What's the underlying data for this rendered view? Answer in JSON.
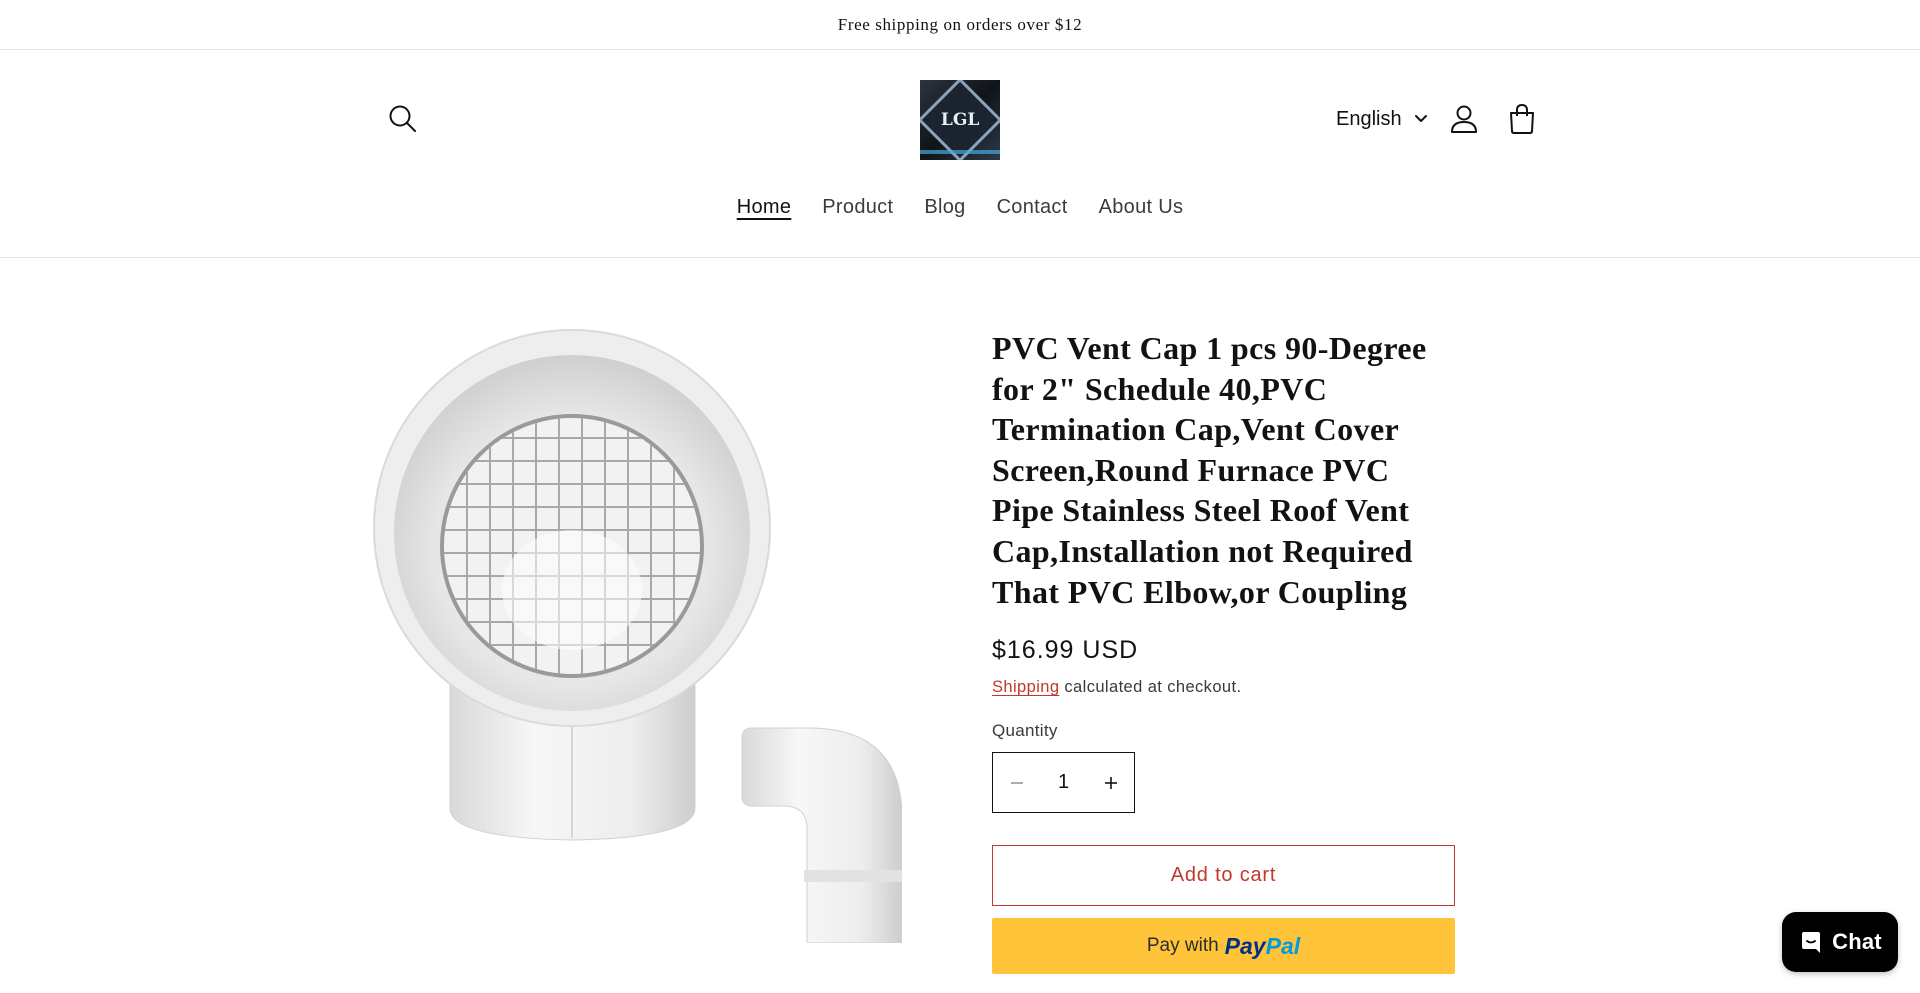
{
  "announcement": {
    "text": "Free shipping on orders over $12"
  },
  "header": {
    "logo_text": "LGL",
    "language": "English",
    "icons": {
      "search": "search-icon",
      "account": "account-icon",
      "cart": "cart-icon",
      "language_caret": "chevron-down-icon"
    }
  },
  "nav": {
    "items": [
      {
        "label": "Home",
        "active": true
      },
      {
        "label": "Product",
        "active": false
      },
      {
        "label": "Blog",
        "active": false
      },
      {
        "label": "Contact",
        "active": false
      },
      {
        "label": "About Us",
        "active": false
      }
    ]
  },
  "product": {
    "title": "PVC Vent Cap 1 pcs 90-Degree for 2\" Schedule 40,PVC Termination Cap,Vent Cover Screen,Round Furnace PVC Pipe Stainless Steel Roof Vent Cap,Installation not Required That PVC Elbow,or Coupling",
    "price": "$16.99 USD",
    "shipping_link": "Shipping",
    "shipping_suffix": " calculated at checkout.",
    "quantity_label": "Quantity",
    "quantity_value": "1",
    "add_to_cart": "Add to cart",
    "paypal_prefix": "Pay with",
    "paypal_brand_1": "Pay",
    "paypal_brand_2": "Pal"
  },
  "chat": {
    "label": "Chat",
    "icon": "chat-bubble-icon"
  },
  "colors": {
    "accent": "#c0392b",
    "paypal_button": "#ffc439",
    "text": "#121212",
    "chat_bg": "#000000"
  }
}
